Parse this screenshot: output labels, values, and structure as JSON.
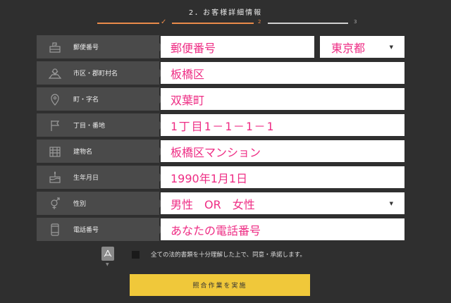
{
  "step": {
    "title": "2．お客様詳細情報",
    "step2": "2",
    "step3": "3"
  },
  "fields": [
    {
      "label": "郵便番号",
      "value": "郵便番号",
      "prefecture": "東京都"
    },
    {
      "label": "市区・郡町村名",
      "value": "板橋区"
    },
    {
      "label": "町・字名",
      "value": "双葉町"
    },
    {
      "label": "丁目・番地",
      "value": "1丁目1－1－1－1"
    },
    {
      "label": "建物名",
      "value": "板橋区マンション"
    },
    {
      "label": "生年月日",
      "value": "1990年1月1日"
    },
    {
      "label": "性別",
      "value": "男性　OR　女性"
    },
    {
      "label": "電話番号",
      "value": "あなたの電話番号"
    }
  ],
  "agreement": {
    "text": "全ての法的書類を十分理解した上で、同意・承諾します。"
  },
  "submit": {
    "label": "照合作業を実施"
  },
  "colors": {
    "background": "#2f2f2f",
    "label_bg": "#4a4a4a",
    "value_text": "#ee2d84",
    "progress_active": "#e98a4a",
    "button": "#f0c83a"
  }
}
